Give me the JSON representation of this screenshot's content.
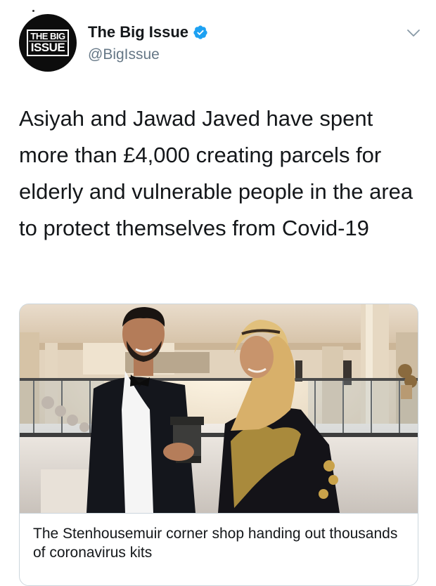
{
  "account": {
    "display_name": "The Big Issue",
    "handle": "@BigIssue",
    "logo_line1": "THE BIG",
    "logo_line2": "ISSUE",
    "verified": true
  },
  "tweet": {
    "text": "Asiyah and Jawad Javed have spent more than £4,000 creating parcels for elderly and vulnerable people in the area to protect themselves from Covid-19"
  },
  "card": {
    "title": "The Stenhousemuir corner shop handing out thousands of coronavirus kits"
  },
  "icons": {
    "verified": "verified-badge-icon",
    "menu": "chevron-down-icon"
  },
  "colors": {
    "text": "#14171a",
    "secondary_text": "#657786",
    "verified_blue": "#1da1f2",
    "card_border": "#ccd6dd"
  }
}
